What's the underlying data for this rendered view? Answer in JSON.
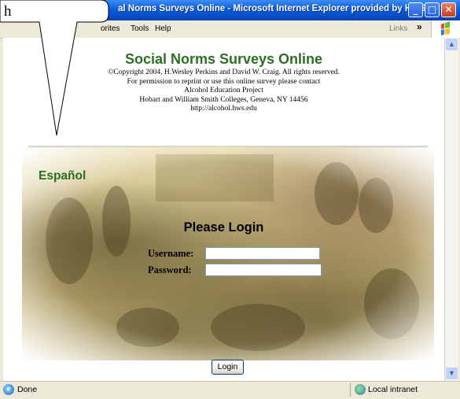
{
  "window": {
    "title": "al Norms Surveys Online - Microsoft Internet Explorer provided by HWS",
    "minimize_glyph": "_",
    "maximize_glyph": "□",
    "close_glyph": "✕"
  },
  "menubar": {
    "items": [
      {
        "label": "orites"
      },
      {
        "label": "Tools"
      },
      {
        "label": "Help"
      }
    ],
    "links_label": "Links",
    "links_chevron": "»"
  },
  "page": {
    "site_title": "Social Norms Surveys Online",
    "credits": [
      "©Copyright 2004, H.Wesley Perkins and David W. Craig. All rights reserved.",
      "For permission to reprint or use this online survey please contact",
      "Alcohol Education Project",
      "Hobart and William Smith Colleges, Geneva, NY 14456",
      "http://alcohol.hws.edu"
    ],
    "language_link": "Español",
    "login_heading": "Please Login",
    "username_label": "Username:",
    "password_label": "Password:",
    "username_value": "",
    "password_value": "",
    "login_button": "Login"
  },
  "statusbar": {
    "status": "Done",
    "zone": "Local intranet"
  },
  "callout": {
    "text": "h"
  },
  "colors": {
    "titlebar": "#0A5DD8",
    "site_title": "#2C6E22",
    "chrome": "#ECE9D8"
  },
  "icons": [
    "ie-page-icon",
    "globe-icon",
    "windows-logo-icon",
    "scroll-up-icon",
    "scroll-down-icon"
  ]
}
